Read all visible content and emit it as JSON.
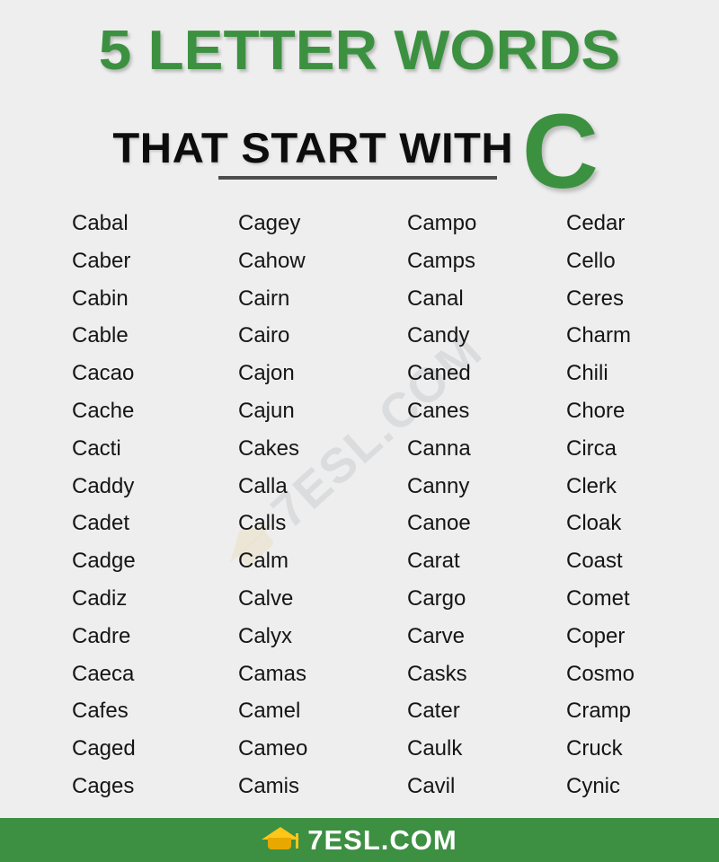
{
  "header": {
    "title_line1": "5 LETTER WORDS",
    "title_line2": "THAT START WITH",
    "title_letter": "C",
    "title_color": "#3c9140",
    "subtitle_color": "#0d0d0d"
  },
  "background_color": "#eeeeee",
  "watermark": {
    "text": "7ESL.COM",
    "icon": "graduation-cap-icon"
  },
  "words": {
    "columns": [
      [
        "Cabal",
        "Caber",
        "Cabin",
        "Cable",
        "Cacao",
        "Cache",
        "Cacti",
        "Caddy",
        "Cadet",
        "Cadge",
        "Cadiz",
        "Cadre",
        "Caeca",
        "Cafes",
        "Caged",
        "Cages"
      ],
      [
        "Cagey",
        "Cahow",
        "Cairn",
        "Cairo",
        "Cajon",
        "Cajun",
        "Cakes",
        "Calla",
        "Calls",
        "Calm",
        "Calve",
        "Calyx",
        "Camas",
        "Camel",
        "Cameo",
        "Camis"
      ],
      [
        "Campo",
        "Camps",
        "Canal",
        "Candy",
        "Caned",
        "Canes",
        "Canna",
        "Canny",
        "Canoe",
        "Carat",
        "Cargo",
        "Carve",
        "Casks",
        "Cater",
        "Caulk",
        "Cavil"
      ],
      [
        "Cedar",
        "Cello",
        "Ceres",
        "Charm",
        "Chili",
        "Chore",
        "Circa",
        "Clerk",
        "Cloak",
        "Coast",
        "Comet",
        "Coper",
        "Cosmo",
        "Cramp",
        "Cruck",
        "Cynic"
      ]
    ]
  },
  "footer": {
    "brand": "7ESL.COM",
    "icon": "graduation-cap-icon",
    "background_color": "#3d8f42",
    "text_color": "#ffffff",
    "icon_color": "#ffc61a"
  }
}
